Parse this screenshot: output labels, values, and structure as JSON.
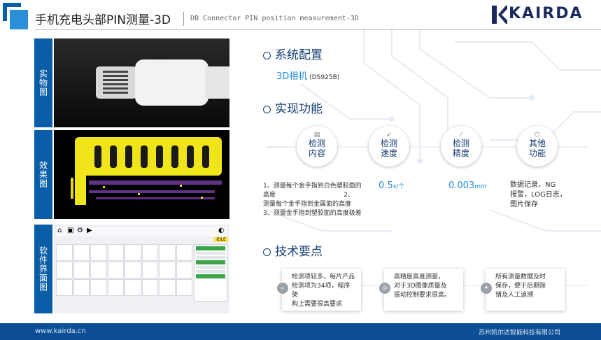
{
  "header": {
    "title": "手机充电头部PIN测量-3D",
    "subtitle": "DB Connector PIN position measurement-3D",
    "logo_text": "KAIRDA"
  },
  "left_panels": [
    {
      "label": "实物图"
    },
    {
      "label": "效果图"
    },
    {
      "label": "软件界面图"
    }
  ],
  "software": {
    "status": "IDLE"
  },
  "system_config": {
    "title": "系统配置",
    "camera": "3D相机",
    "model": "(DS925B)"
  },
  "functions": {
    "title": "实现功能",
    "items": [
      {
        "line1": "检测",
        "line2": "内容",
        "icon": "doc-icon"
      },
      {
        "line1": "检测",
        "line2": "速度",
        "icon": "rocket-icon"
      },
      {
        "line1": "检测",
        "line2": "精度",
        "icon": "ruler-icon"
      },
      {
        "line1": "其他",
        "line2": "功能",
        "icon": "cube-icon"
      }
    ],
    "content_lines": [
      "1、测量每个金手指到白色塑胶面的",
      "高度                                  2、",
      "测量每个金手指到金属面的高度",
      "3、测量金手指到塑胶面的高度极差"
    ],
    "speed_value": "0.5",
    "speed_unit": "s/个",
    "precision_value": "0.003",
    "precision_unit": "mm",
    "other_lines": [
      "数据记录，NG",
      "报警，LOG日志，",
      "图片保存"
    ]
  },
  "tech": {
    "title": "技术要点",
    "points": [
      {
        "lines": [
          "检测项较多，每片产品",
          "检测项为34项，程序架",
          "构上需要很高要求"
        ]
      },
      {
        "lines": [
          "高精度高度测量，",
          "对于3D图像质量及",
          "振动控制要求很高。"
        ]
      },
      {
        "lines": [
          "所有测量数据及时",
          "保存，便于后期除",
          "错及人工追溯"
        ]
      }
    ]
  },
  "footer": {
    "website": "www.kairda.cn",
    "company": "苏州凯尔达智能科技有限公司"
  },
  "colors": {
    "primary": "#0a5ea8",
    "title": "#123d73",
    "accent": "#2a8ed8",
    "footer": "#0c4f96"
  }
}
